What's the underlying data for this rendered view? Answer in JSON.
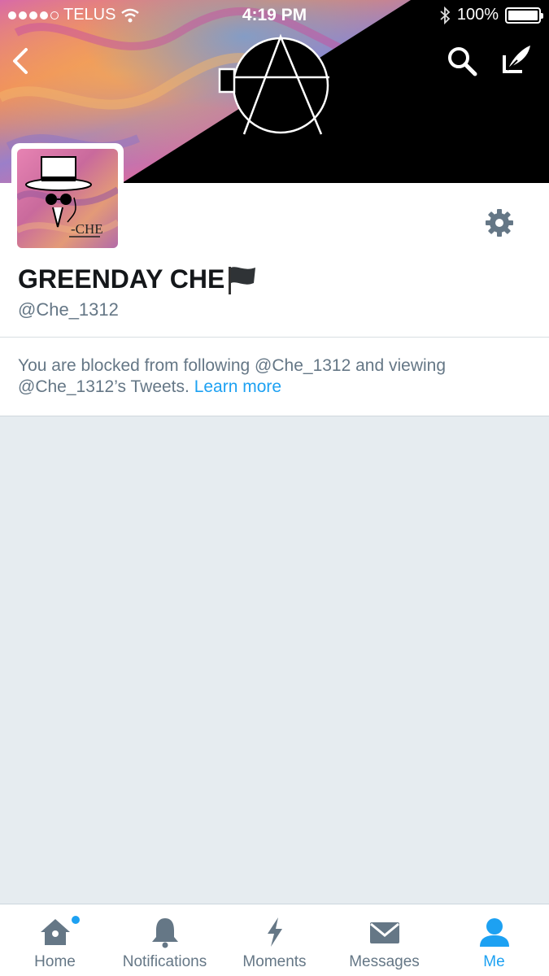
{
  "status_bar": {
    "carrier": "TELUS",
    "time": "4:19 PM",
    "battery": "100%",
    "battery_level": 1.0,
    "signal_bars_filled": 4,
    "signal_bars_total": 5
  },
  "nav": {
    "back_icon": "chevron-left-icon",
    "search_icon": "search-icon",
    "compose_icon": "compose-icon"
  },
  "profile": {
    "display_name": "GREENDAY CHE",
    "screen_name": "@Che_1312",
    "avatar_text": "CHE",
    "settings_icon": "gear-icon"
  },
  "blocked_notice": {
    "message": "You are blocked from following @Che_1312 and viewing @Che_1312’s Tweets.",
    "link": "Learn more"
  },
  "tabs": [
    {
      "label": "Home",
      "icon": "home-icon",
      "active": false,
      "has_badge": true
    },
    {
      "label": "Notifications",
      "icon": "bell-icon",
      "active": false,
      "has_badge": false
    },
    {
      "label": "Moments",
      "icon": "lightning-icon",
      "active": false,
      "has_badge": false
    },
    {
      "label": "Messages",
      "icon": "envelope-icon",
      "active": false,
      "has_badge": false
    },
    {
      "label": "Me",
      "icon": "person-icon",
      "active": true,
      "has_badge": false
    }
  ],
  "colors": {
    "accent": "#1da1f2",
    "muted_text": "#657786",
    "background": "#e6ecf0",
    "banner_black": "#000000"
  }
}
